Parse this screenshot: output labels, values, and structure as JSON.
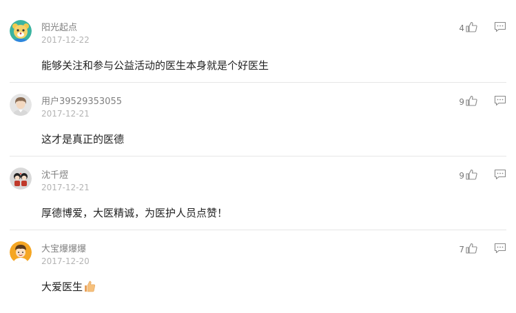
{
  "comments": [
    {
      "username": "阳光起点",
      "date": "2017-12-22",
      "content": "能够关注和参与公益活动的医生本身就是个好医生",
      "likes": "4",
      "avatar_icon": "cartoon-bear-avatar-icon"
    },
    {
      "username": "用户39529353055",
      "date": "2017-12-21",
      "content": "这才是真正的医德",
      "likes": "9",
      "avatar_icon": "default-user-avatar-icon"
    },
    {
      "username": "沈千熤",
      "date": "2017-12-21",
      "content": "厚德博爱，大医精诚，为医护人员点赞！",
      "likes": "9",
      "avatar_icon": "cartoon-couple-avatar-icon"
    },
    {
      "username": "大宝爆爆爆",
      "date": "2017-12-20",
      "content": "大爱医生",
      "likes": "7",
      "avatar_icon": "cartoon-boy-avatar-icon",
      "content_emoji": "thumbs-up-emoji-icon"
    }
  ],
  "colors": {
    "username": "#808080",
    "date": "#b3b3b3",
    "content": "#222222",
    "icon": "#888888",
    "divider": "#e6e6e6"
  }
}
